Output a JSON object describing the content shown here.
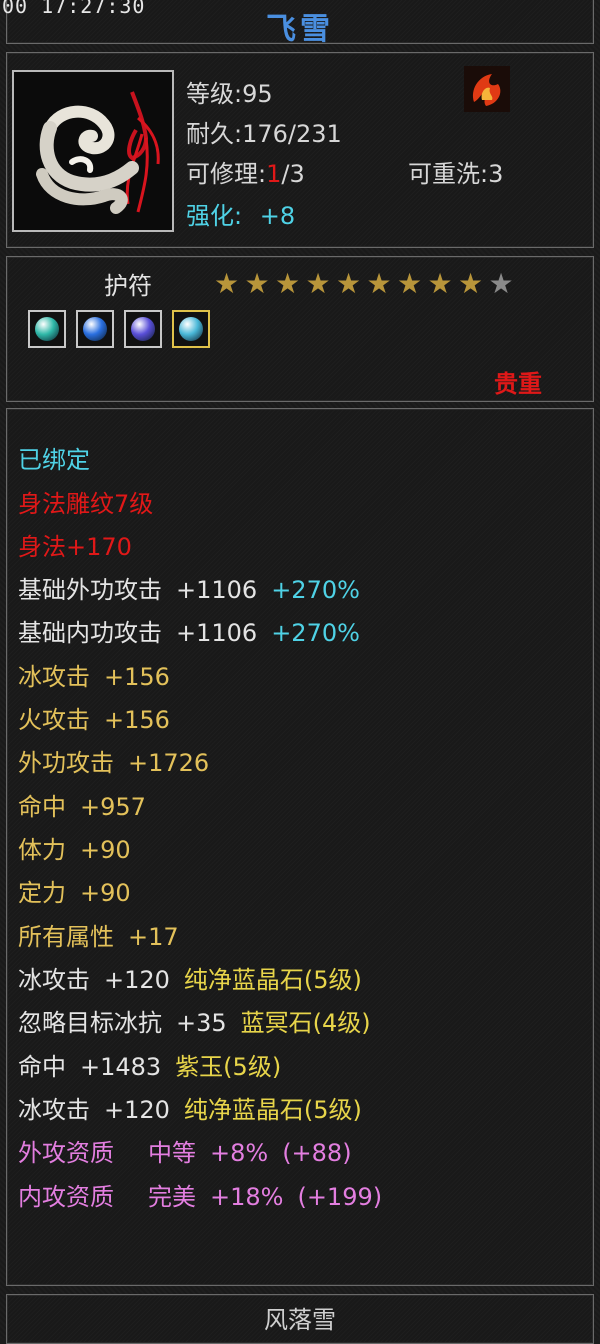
{
  "header": {
    "timestamp": "00 17:27:30",
    "title": "飞雪"
  },
  "item": {
    "level_label": "等级:95",
    "durability_label": "耐久:176/231",
    "repair_prefix": "可修理:",
    "repair_current": "1",
    "repair_suffix": "/3",
    "rewash_label": "可重洗:3",
    "enhance_label": "强化:",
    "enhance_value": "+8",
    "type_label": "护符",
    "stars_filled": 9,
    "stars_total": 10,
    "rarity_label": "贵重",
    "gem_slots": [
      {
        "name": "gem-slot-1",
        "color": "#2fb8a8",
        "selected": false
      },
      {
        "name": "gem-slot-2",
        "color": "#2a6fe0",
        "selected": false
      },
      {
        "name": "gem-slot-3",
        "color": "#5a4fd8",
        "selected": false
      },
      {
        "name": "gem-slot-4",
        "color": "#4ab8d8",
        "selected": true
      }
    ]
  },
  "attributes": {
    "bound": "已绑定",
    "engrave": "身法雕纹7级",
    "agility": "身法+170",
    "base_ext_attack": {
      "label": "基础外功攻击",
      "value": "+1106",
      "bonus": "+270%"
    },
    "base_int_attack": {
      "label": "基础内功攻击",
      "value": "+1106",
      "bonus": "+270%"
    },
    "ice_attack": {
      "label": "冰攻击",
      "value": "+156"
    },
    "fire_attack": {
      "label": "火攻击",
      "value": "+156"
    },
    "ext_attack": {
      "label": "外功攻击",
      "value": "+1726"
    },
    "hit": {
      "label": "命中",
      "value": "+957"
    },
    "stamina": {
      "label": "体力",
      "value": "+90"
    },
    "focus": {
      "label": "定力",
      "value": "+90"
    },
    "all_attr": {
      "label": "所有属性",
      "value": "+17"
    },
    "gem1": {
      "label": "冰攻击",
      "value": "+120",
      "gem": "纯净蓝晶石(5级)"
    },
    "gem2": {
      "label": "忽略目标冰抗",
      "value": "+35",
      "gem": "蓝冥石(4级)"
    },
    "gem3": {
      "label": "命中",
      "value": "+1483",
      "gem": "紫玉(5级)"
    },
    "gem4": {
      "label": "冰攻击",
      "value": "+120",
      "gem": "纯净蓝晶石(5级)"
    },
    "ext_aptitude": {
      "label": "外攻资质",
      "grade": "中等",
      "value": "+8%",
      "extra": "(+88)"
    },
    "int_aptitude": {
      "label": "内攻资质",
      "grade": "完美",
      "value": "+18%",
      "extra": "(+199)"
    }
  },
  "footer": {
    "owner": "风落雪"
  }
}
